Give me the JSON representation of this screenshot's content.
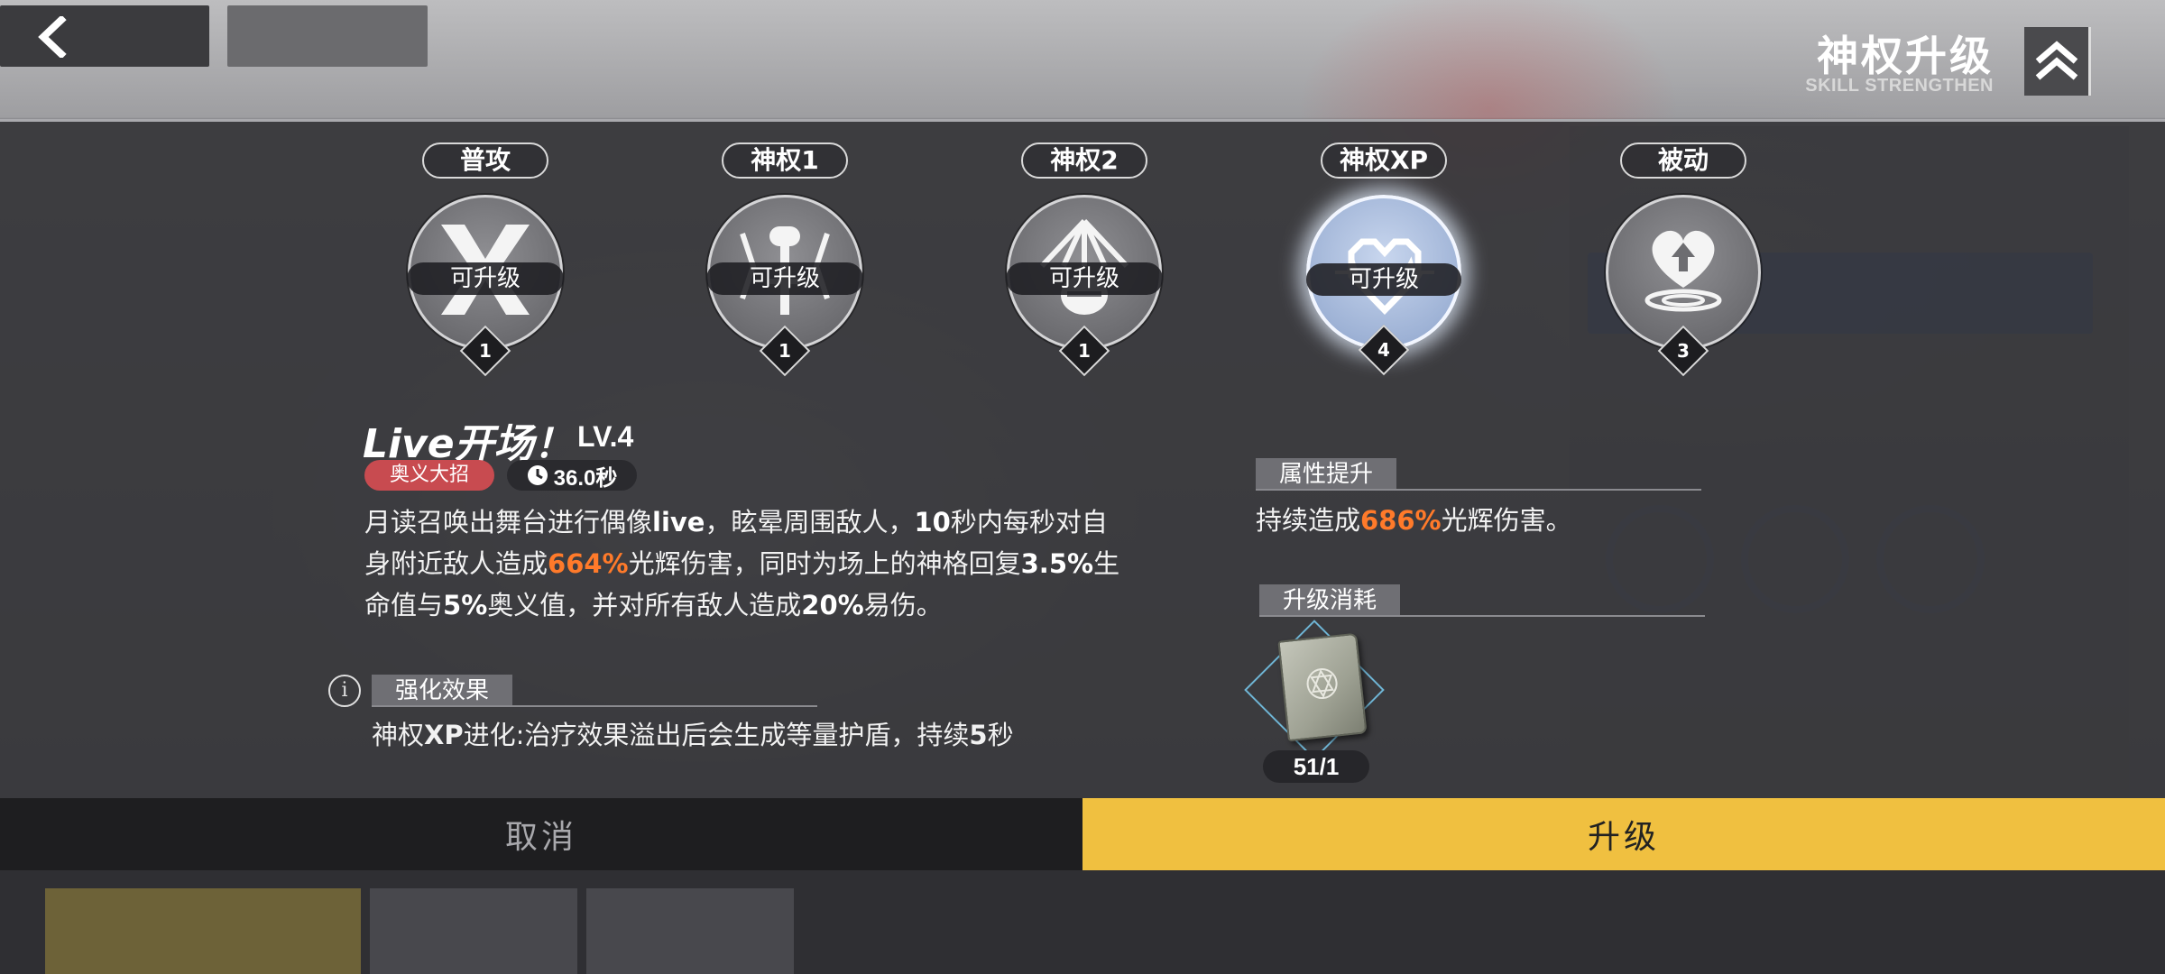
{
  "header": {
    "title": "神权升级",
    "subtitle": "SKILL STRENGTHEN"
  },
  "tabs": [
    {
      "label": "普攻",
      "status": "可升级",
      "level": "1",
      "icon": "x-slash-icon"
    },
    {
      "label": "神权1",
      "status": "可升级",
      "level": "1",
      "icon": "microphone-stand-icon"
    },
    {
      "label": "神权2",
      "status": "可升级",
      "level": "1",
      "icon": "stage-spotlight-icon"
    },
    {
      "label": "神权XP",
      "status": "可升级",
      "level": "4",
      "icon": "pixel-heart-icon",
      "active": true
    },
    {
      "label": "被动",
      "status": "",
      "level": "3",
      "icon": "heart-up-arrow-icon"
    }
  ],
  "skill": {
    "name": "Live开场！",
    "level": "LV.4",
    "type_badge": "奥义大招",
    "cooldown": "36.0秒",
    "description": {
      "t1": "月读召唤出舞台进行偶像",
      "b1": "live",
      "t2": "，眩晕周围敌人，",
      "b2": "10",
      "t3": "秒内每秒对自身附近敌人造成",
      "h1": "664%",
      "t4": "光辉伤害，同时为场上的神格回复",
      "b3": "3.5%",
      "t5": "生命值与",
      "b4": "5%",
      "t6": "奥义值，并对所有敌人造成",
      "b5": "20%",
      "t7": "易伤。"
    }
  },
  "enhance": {
    "title": "强化效果",
    "prefix": "神权",
    "bold_xp": "XP",
    "text_mid": "进化:治疗效果溢出后会生成等量护盾，持续",
    "bold_num": "5",
    "suffix": "秒"
  },
  "attribute": {
    "title": "属性提升",
    "prefix": "持续造成",
    "value": "686%",
    "suffix": "光辉伤害。"
  },
  "cost": {
    "title": "升级消耗",
    "count": "51/1",
    "icon": "skill-book-icon"
  },
  "buttons": {
    "cancel": "取消",
    "upgrade": "升级"
  },
  "colors": {
    "highlight": "#ff7a2a",
    "upgrade_button": "#f0c040",
    "type_badge": "#c84b50"
  }
}
